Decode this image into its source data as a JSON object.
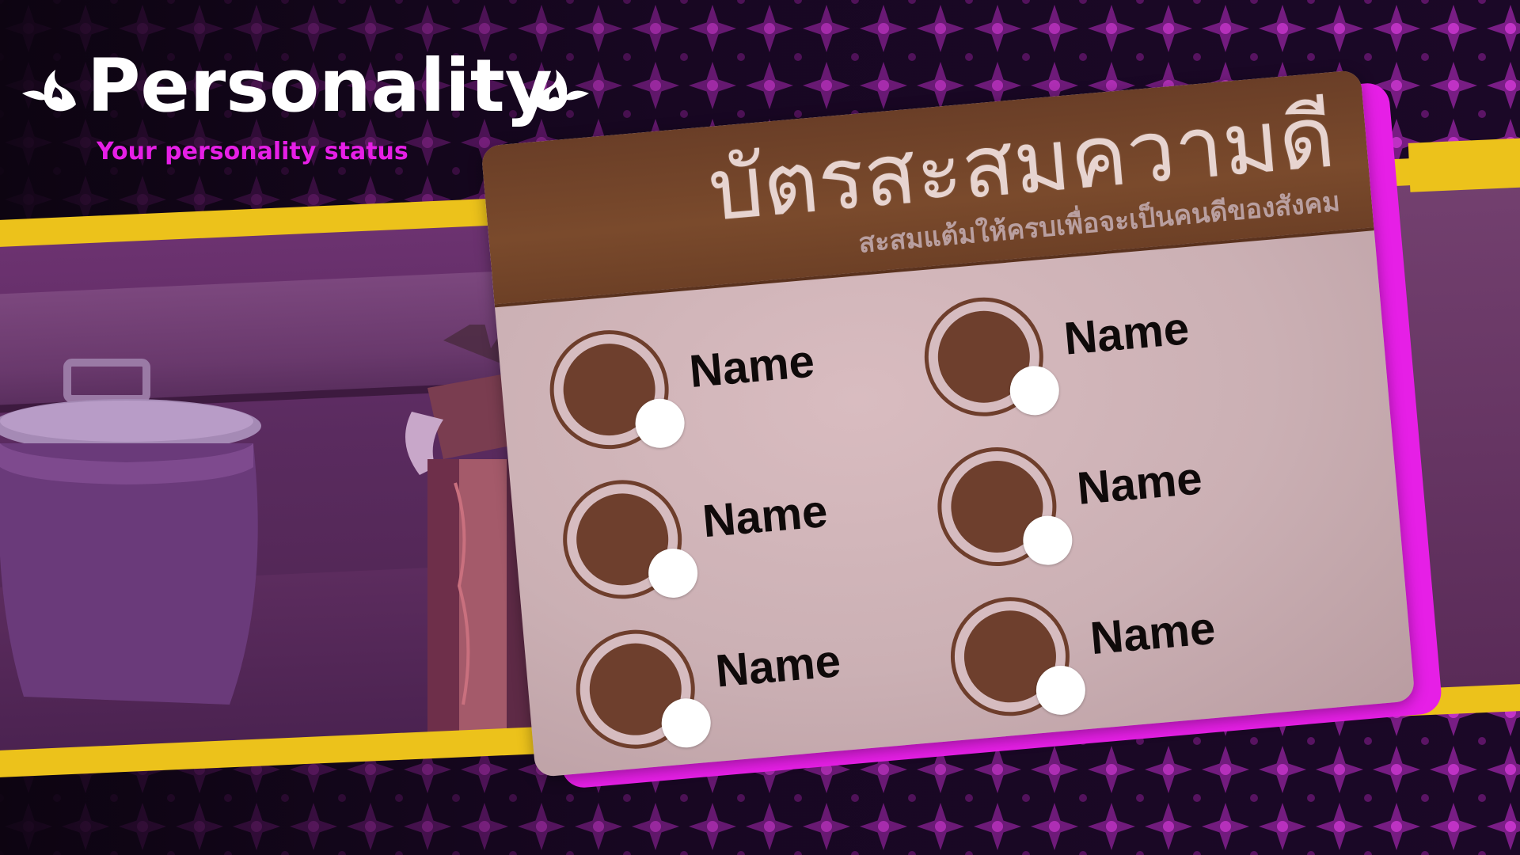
{
  "header": {
    "title": "Personality",
    "subtitle": "Your personality status"
  },
  "card": {
    "title": "บัตรสะสมความดี",
    "subtitle": "สะสมแต้มให้ครบเพื่อจะเป็นคนดีของสังคม",
    "stamps": [
      {
        "name": "Name"
      },
      {
        "name": "Name"
      },
      {
        "name": "Name"
      },
      {
        "name": "Name"
      },
      {
        "name": "Name"
      },
      {
        "name": "Name"
      }
    ]
  },
  "colors": {
    "accent_magenta": "#e61fe6",
    "band_yellow": "#ecc21b",
    "card_header_brown": "#6a3e27",
    "stamp_brown": "#6e3f2d",
    "background_purple": "#2a0d38"
  },
  "icons": {
    "ornament": "flame-swirl-icon",
    "stamp_marker": "dot-icon"
  }
}
